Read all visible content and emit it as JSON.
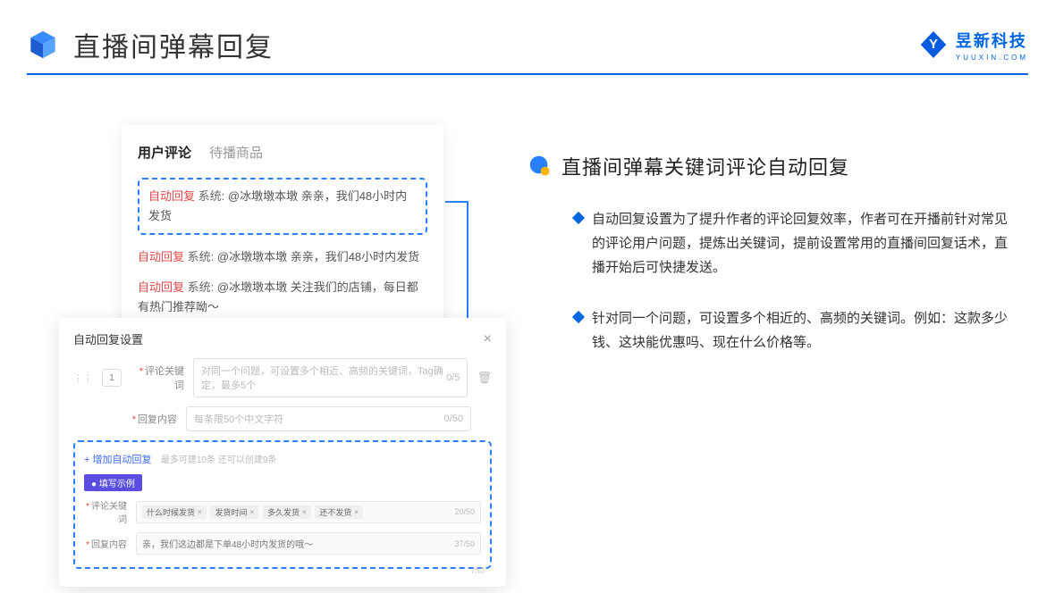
{
  "header": {
    "title": "直播间弹幕回复",
    "brand_name": "昱新科技",
    "brand_sub": "YUUXIN.COM"
  },
  "card1": {
    "tabs": {
      "active": "用户评论",
      "inactive": "待播商品"
    },
    "rows": [
      {
        "tag_auto": "自动回复",
        "tag_sys": "系统:",
        "body": "@冰墩墩本墩 亲亲，我们48小时内发货"
      },
      {
        "tag_auto": "自动回复",
        "tag_sys": "系统:",
        "body": "@冰墩墩本墩 亲亲，我们48小时内发货"
      },
      {
        "tag_auto": "自动回复",
        "tag_sys": "系统:",
        "body": "@冰墩墩本墩 关注我们的店铺，每日都有热门推荐呦～"
      }
    ]
  },
  "card2": {
    "title": "自动回复设置",
    "count": "1",
    "keyword_label": "评论关键词",
    "keyword_placeholder": "对同一个问题，可设置多个相近、高频的关键词，Tag确定，最多5个",
    "keyword_count": "0/5",
    "content_label": "回复内容",
    "content_placeholder": "每条限50个中文字符",
    "content_count": "0/50",
    "add_link": "+ 增加自动回复",
    "add_hint": "最多可建10条 还可以创建9条",
    "example_tag": "● 填写示例",
    "ex_keyword_label": "评论关键词",
    "ex_tags": [
      "什么时候发货",
      "发货时间",
      "多久发货",
      "还不发货"
    ],
    "ex_keyword_count": "20/50",
    "ex_content_label": "回复内容",
    "ex_content_value": "亲，我们这边都是下单48小时内发货的哦～",
    "ex_content_count": "37/50",
    "stray": "/50"
  },
  "right": {
    "title": "直播间弹幕关键词评论自动回复",
    "bullets": [
      "自动回复设置为了提升作者的评论回复效率，作者可在开播前针对常见的评论用户问题，提炼出关键词，提前设置常用的直播间回复话术，直播开始后可快捷发送。",
      "针对同一个问题，可设置多个相近的、高频的关键词。例如：这款多少钱、这块能优惠吗、现在什么价格等。"
    ]
  }
}
